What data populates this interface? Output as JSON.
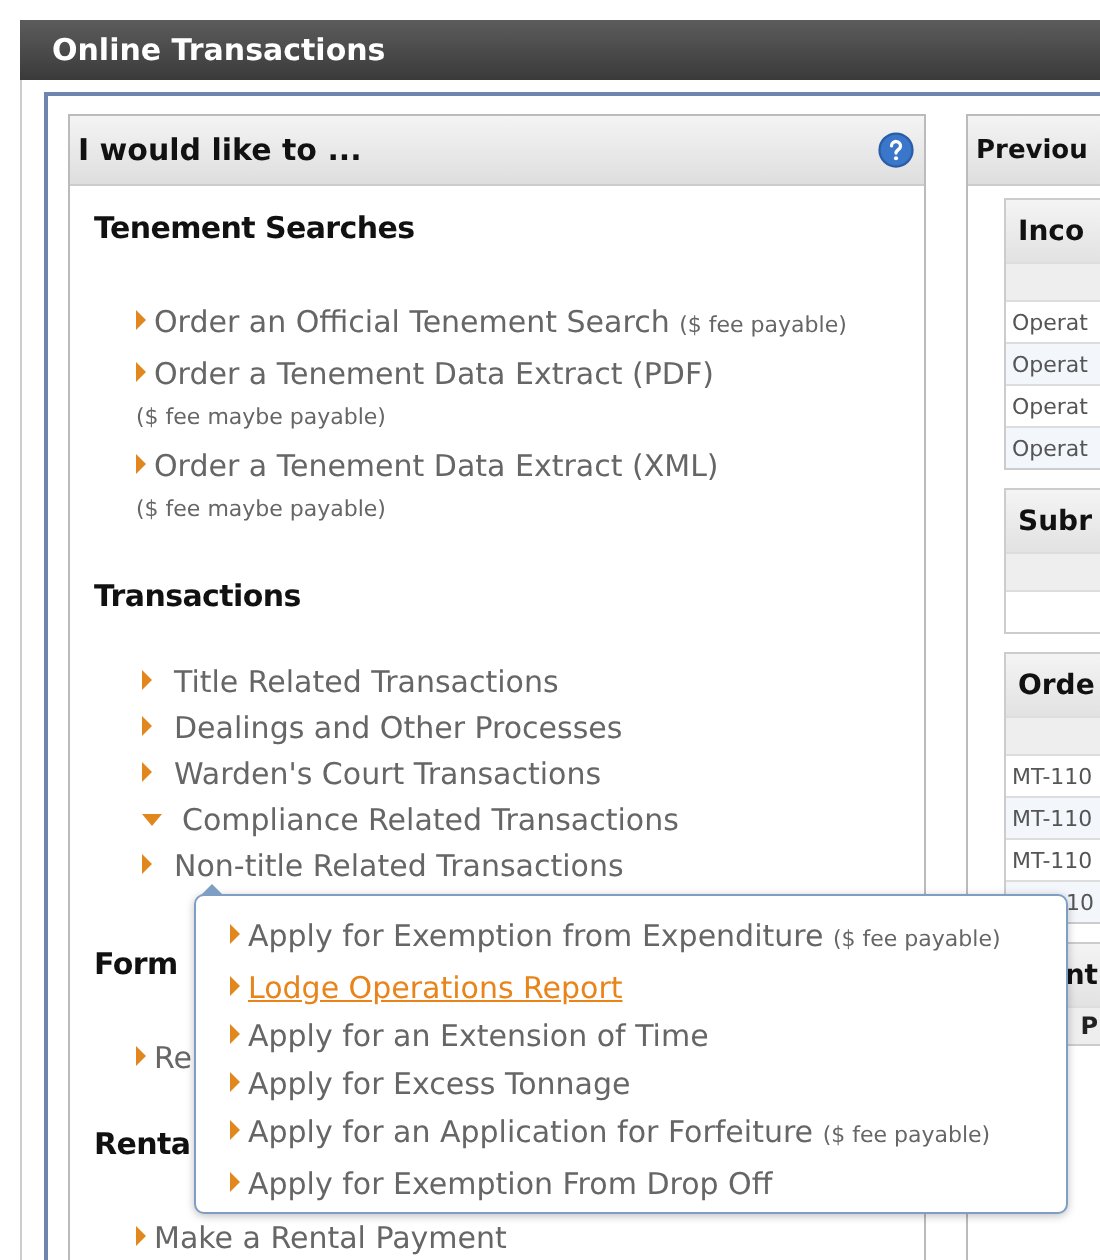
{
  "header": {
    "title": "Online Transactions"
  },
  "left_panel": {
    "title": "I would like to ...",
    "sections": [
      {
        "heading": "Tenement Searches",
        "kind": "links",
        "links": [
          {
            "label": "Order an Official Tenement Search",
            "note": "($ fee payable)"
          },
          {
            "label": "Order a Tenement Data Extract (PDF)",
            "note": "($ fee maybe payable)"
          },
          {
            "label": "Order a Tenement Data Extract (XML)",
            "note": "($ fee maybe payable)"
          }
        ]
      },
      {
        "heading": "Transactions",
        "kind": "tree",
        "items": [
          {
            "label": "Title Related Transactions",
            "expanded": false
          },
          {
            "label": "Dealings and Other Processes",
            "expanded": false
          },
          {
            "label": "Warden's Court Transactions",
            "expanded": false
          },
          {
            "label": "Compliance Related Transactions",
            "expanded": true
          },
          {
            "label": "Non-title Related Transactions",
            "expanded": false
          }
        ]
      },
      {
        "heading": "Form",
        "kind": "links",
        "links": [
          {
            "label": "Re"
          }
        ]
      },
      {
        "heading": "Renta",
        "kind": "links",
        "links": [
          {
            "label": "Make a Rental Payment"
          }
        ]
      }
    ]
  },
  "popover": {
    "items": [
      {
        "label": "Apply for Exemption from Expenditure",
        "note": "($ fee payable)",
        "hovered": false
      },
      {
        "label": "Lodge Operations Report",
        "hovered": true
      },
      {
        "label": "Apply for an Extension of Time",
        "hovered": false
      },
      {
        "label": "Apply for Excess Tonnage",
        "hovered": false
      },
      {
        "label": "Apply for an Application for Forfeiture",
        "note": "($ fee payable)",
        "hovered": false
      },
      {
        "label": "Apply for Exemption From Drop Off",
        "hovered": false
      }
    ]
  },
  "right_panel": {
    "title": "Previou",
    "boxes": [
      {
        "title": "Inco",
        "cut_left": false,
        "rows": [
          {
            "text": "Operat",
            "cut_left": false
          },
          {
            "text": "Operat",
            "cut_left": false
          },
          {
            "text": "Operat",
            "cut_left": false
          },
          {
            "text": "Operat",
            "cut_left": false
          }
        ]
      },
      {
        "title": "Subr",
        "cut_left": false
      },
      {
        "title": "Orde",
        "cut_left": false,
        "rows": [
          {
            "text": "MT-110",
            "cut_left": false
          },
          {
            "text": "MT-110",
            "cut_left": false
          },
          {
            "text": "MT-110",
            "cut_left": false
          },
          {
            "text": "10",
            "cut_left": true
          }
        ]
      },
      {
        "title": "nt",
        "subheader": "P",
        "cut_left": true
      }
    ]
  }
}
